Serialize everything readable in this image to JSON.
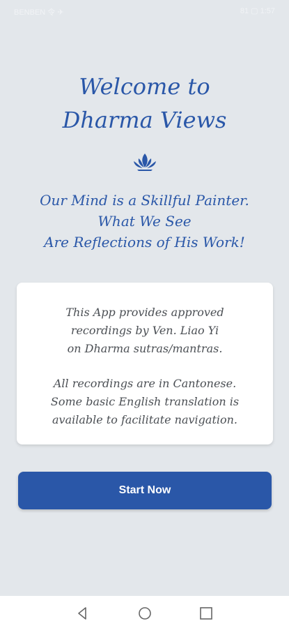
{
  "status_bar": {
    "left_text": "BENBEN 令 ✈",
    "right_text": "81 ▢ 1:57"
  },
  "welcome": {
    "line1": "Welcome to",
    "line2": "Dharma Views"
  },
  "motto": {
    "line1": "Our Mind is a Skillful Painter.",
    "line2": "What We See",
    "line3": "Are Reflections of His Work!"
  },
  "info": {
    "p1_line1": "This App provides approved",
    "p1_line2": "recordings by Ven. Liao Yi",
    "p1_line3": "on Dharma sutras/mantras.",
    "p2_line1": "All recordings are in Cantonese.",
    "p2_line2": "Some basic English translation is",
    "p2_line3": "available to facilitate navigation."
  },
  "start_button": {
    "label": "Start Now"
  },
  "icons": {
    "lotus": "lotus-icon",
    "back": "back-triangle-icon",
    "home": "home-circle-icon",
    "recent": "recent-square-icon"
  },
  "colors": {
    "accent": "#2a57a8",
    "background": "#e3e7eb",
    "card": "#ffffff",
    "body_text": "#4b4f54"
  }
}
